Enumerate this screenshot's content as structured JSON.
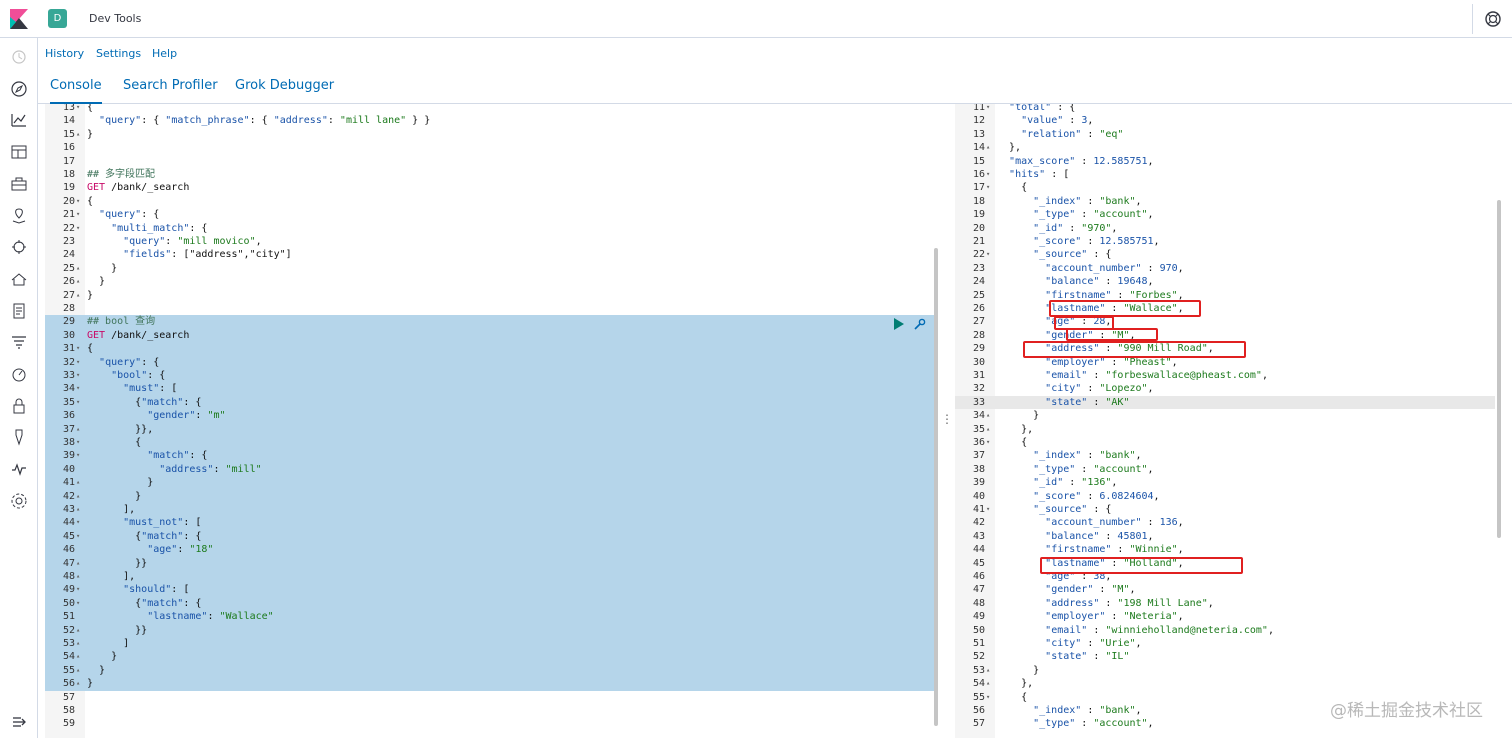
{
  "header": {
    "space_initial": "D",
    "app_title": "Dev Tools"
  },
  "menu": {
    "items": [
      "History",
      "Settings",
      "Help"
    ]
  },
  "tabs": [
    "Console",
    "Search Profiler",
    "Grok Debugger"
  ],
  "nav_icons": [
    "recent-icon",
    "discover-icon",
    "visualize-icon",
    "dashboard-icon",
    "canvas-icon",
    "maps-icon",
    "ml-icon",
    "infrastructure-icon",
    "logs-icon",
    "apm-icon",
    "uptime-icon",
    "siem-icon",
    "devtools-icon",
    "monitoring-icon",
    "management-icon"
  ],
  "request_lines": [
    {
      "n": "13",
      "f": "▾",
      "t": "{"
    },
    {
      "n": "14",
      "f": "",
      "t": "  \"query\": { \"match_phrase\": { \"address\": \"mill lane\" } }"
    },
    {
      "n": "15",
      "f": "▴",
      "t": "}"
    },
    {
      "n": "16",
      "f": "",
      "t": ""
    },
    {
      "n": "17",
      "f": "",
      "t": ""
    },
    {
      "n": "18",
      "f": "",
      "t": "## 多字段匹配"
    },
    {
      "n": "19",
      "f": "",
      "t": "GET /bank/_search"
    },
    {
      "n": "20",
      "f": "▾",
      "t": "{"
    },
    {
      "n": "21",
      "f": "▾",
      "t": "  \"query\": {"
    },
    {
      "n": "22",
      "f": "▾",
      "t": "    \"multi_match\": {"
    },
    {
      "n": "23",
      "f": "",
      "t": "      \"query\": \"mill movico\","
    },
    {
      "n": "24",
      "f": "",
      "t": "      \"fields\": [\"address\",\"city\"]"
    },
    {
      "n": "25",
      "f": "▴",
      "t": "    }"
    },
    {
      "n": "26",
      "f": "▴",
      "t": "  }"
    },
    {
      "n": "27",
      "f": "▴",
      "t": "}"
    },
    {
      "n": "28",
      "f": "",
      "t": ""
    },
    {
      "n": "29",
      "f": "",
      "t": "## bool 查询"
    },
    {
      "n": "30",
      "f": "",
      "t": "GET /bank/_search"
    },
    {
      "n": "31",
      "f": "▾",
      "t": "{"
    },
    {
      "n": "32",
      "f": "▾",
      "t": "  \"query\": {"
    },
    {
      "n": "33",
      "f": "▾",
      "t": "    \"bool\": {"
    },
    {
      "n": "34",
      "f": "▾",
      "t": "      \"must\": ["
    },
    {
      "n": "35",
      "f": "▾",
      "t": "        {\"match\": {"
    },
    {
      "n": "36",
      "f": "",
      "t": "          \"gender\": \"m\""
    },
    {
      "n": "37",
      "f": "▴",
      "t": "        }},"
    },
    {
      "n": "38",
      "f": "▾",
      "t": "        {"
    },
    {
      "n": "39",
      "f": "▾",
      "t": "          \"match\": {"
    },
    {
      "n": "40",
      "f": "",
      "t": "            \"address\": \"mill\""
    },
    {
      "n": "41",
      "f": "▴",
      "t": "          }"
    },
    {
      "n": "42",
      "f": "▴",
      "t": "        }"
    },
    {
      "n": "43",
      "f": "▴",
      "t": "      ],"
    },
    {
      "n": "44",
      "f": "▾",
      "t": "      \"must_not\": ["
    },
    {
      "n": "45",
      "f": "▾",
      "t": "        {\"match\": {"
    },
    {
      "n": "46",
      "f": "",
      "t": "          \"age\": \"18\""
    },
    {
      "n": "47",
      "f": "▴",
      "t": "        }}"
    },
    {
      "n": "48",
      "f": "▴",
      "t": "      ],"
    },
    {
      "n": "49",
      "f": "▾",
      "t": "      \"should\": ["
    },
    {
      "n": "50",
      "f": "▾",
      "t": "        {\"match\": {"
    },
    {
      "n": "51",
      "f": "",
      "t": "          \"lastname\": \"Wallace\""
    },
    {
      "n": "52",
      "f": "▴",
      "t": "        }}"
    },
    {
      "n": "53",
      "f": "▴",
      "t": "      ]"
    },
    {
      "n": "54",
      "f": "▴",
      "t": "    }"
    },
    {
      "n": "55",
      "f": "▴",
      "t": "  }"
    },
    {
      "n": "56",
      "f": "▴",
      "t": "}"
    },
    {
      "n": "57",
      "f": "",
      "t": ""
    },
    {
      "n": "58",
      "f": "",
      "t": ""
    },
    {
      "n": "59",
      "f": "",
      "t": ""
    }
  ],
  "response_lines": [
    {
      "n": "11",
      "f": "▾",
      "t": "  \"total\" : {"
    },
    {
      "n": "12",
      "f": "",
      "t": "    \"value\" : 3,"
    },
    {
      "n": "13",
      "f": "",
      "t": "    \"relation\" : \"eq\""
    },
    {
      "n": "14",
      "f": "▴",
      "t": "  },"
    },
    {
      "n": "15",
      "f": "",
      "t": "  \"max_score\" : 12.585751,"
    },
    {
      "n": "16",
      "f": "▾",
      "t": "  \"hits\" : ["
    },
    {
      "n": "17",
      "f": "▾",
      "t": "    {"
    },
    {
      "n": "18",
      "f": "",
      "t": "      \"_index\" : \"bank\","
    },
    {
      "n": "19",
      "f": "",
      "t": "      \"_type\" : \"account\","
    },
    {
      "n": "20",
      "f": "",
      "t": "      \"_id\" : \"970\","
    },
    {
      "n": "21",
      "f": "",
      "t": "      \"_score\" : 12.585751,"
    },
    {
      "n": "22",
      "f": "▾",
      "t": "      \"_source\" : {"
    },
    {
      "n": "23",
      "f": "",
      "t": "        \"account_number\" : 970,"
    },
    {
      "n": "24",
      "f": "",
      "t": "        \"balance\" : 19648,"
    },
    {
      "n": "25",
      "f": "",
      "t": "        \"firstname\" : \"Forbes\","
    },
    {
      "n": "26",
      "f": "",
      "t": "        \"lastname\" : \"Wallace\","
    },
    {
      "n": "27",
      "f": "",
      "t": "        \"age\" : 28,"
    },
    {
      "n": "28",
      "f": "",
      "t": "        \"gender\" : \"M\","
    },
    {
      "n": "29",
      "f": "",
      "t": "        \"address\" : \"990 Mill Road\","
    },
    {
      "n": "30",
      "f": "",
      "t": "        \"employer\" : \"Pheast\","
    },
    {
      "n": "31",
      "f": "",
      "t": "        \"email\" : \"forbeswallace@pheast.com\","
    },
    {
      "n": "32",
      "f": "",
      "t": "        \"city\" : \"Lopezo\","
    },
    {
      "n": "33",
      "f": "",
      "t": "        \"state\" : \"AK\""
    },
    {
      "n": "34",
      "f": "▴",
      "t": "      }"
    },
    {
      "n": "35",
      "f": "▴",
      "t": "    },"
    },
    {
      "n": "36",
      "f": "▾",
      "t": "    {"
    },
    {
      "n": "37",
      "f": "",
      "t": "      \"_index\" : \"bank\","
    },
    {
      "n": "38",
      "f": "",
      "t": "      \"_type\" : \"account\","
    },
    {
      "n": "39",
      "f": "",
      "t": "      \"_id\" : \"136\","
    },
    {
      "n": "40",
      "f": "",
      "t": "      \"_score\" : 6.0824604,"
    },
    {
      "n": "41",
      "f": "▾",
      "t": "      \"_source\" : {"
    },
    {
      "n": "42",
      "f": "",
      "t": "        \"account_number\" : 136,"
    },
    {
      "n": "43",
      "f": "",
      "t": "        \"balance\" : 45801,"
    },
    {
      "n": "44",
      "f": "",
      "t": "        \"firstname\" : \"Winnie\","
    },
    {
      "n": "45",
      "f": "",
      "t": "        \"lastname\" : \"Holland\","
    },
    {
      "n": "46",
      "f": "",
      "t": "        \"age\" : 38,"
    },
    {
      "n": "47",
      "f": "",
      "t": "        \"gender\" : \"M\","
    },
    {
      "n": "48",
      "f": "",
      "t": "        \"address\" : \"198 Mill Lane\","
    },
    {
      "n": "49",
      "f": "",
      "t": "        \"employer\" : \"Neteria\","
    },
    {
      "n": "50",
      "f": "",
      "t": "        \"email\" : \"winnieholland@neteria.com\","
    },
    {
      "n": "51",
      "f": "",
      "t": "        \"city\" : \"Urie\","
    },
    {
      "n": "52",
      "f": "",
      "t": "        \"state\" : \"IL\""
    },
    {
      "n": "53",
      "f": "▴",
      "t": "      }"
    },
    {
      "n": "54",
      "f": "▴",
      "t": "    },"
    },
    {
      "n": "55",
      "f": "▾",
      "t": "    {"
    },
    {
      "n": "56",
      "f": "",
      "t": "      \"_index\" : \"bank\","
    },
    {
      "n": "57",
      "f": "",
      "t": "      \"_type\" : \"account\","
    }
  ],
  "selected_request_lines": [
    "29",
    "56"
  ],
  "cursor_line": "33",
  "watermark": "@稀土掘金技术社区",
  "colors": {
    "accent": "#006bb4",
    "selection": "#b5d5ea",
    "annotation": "#e02020",
    "space_badge": "#37a796"
  }
}
